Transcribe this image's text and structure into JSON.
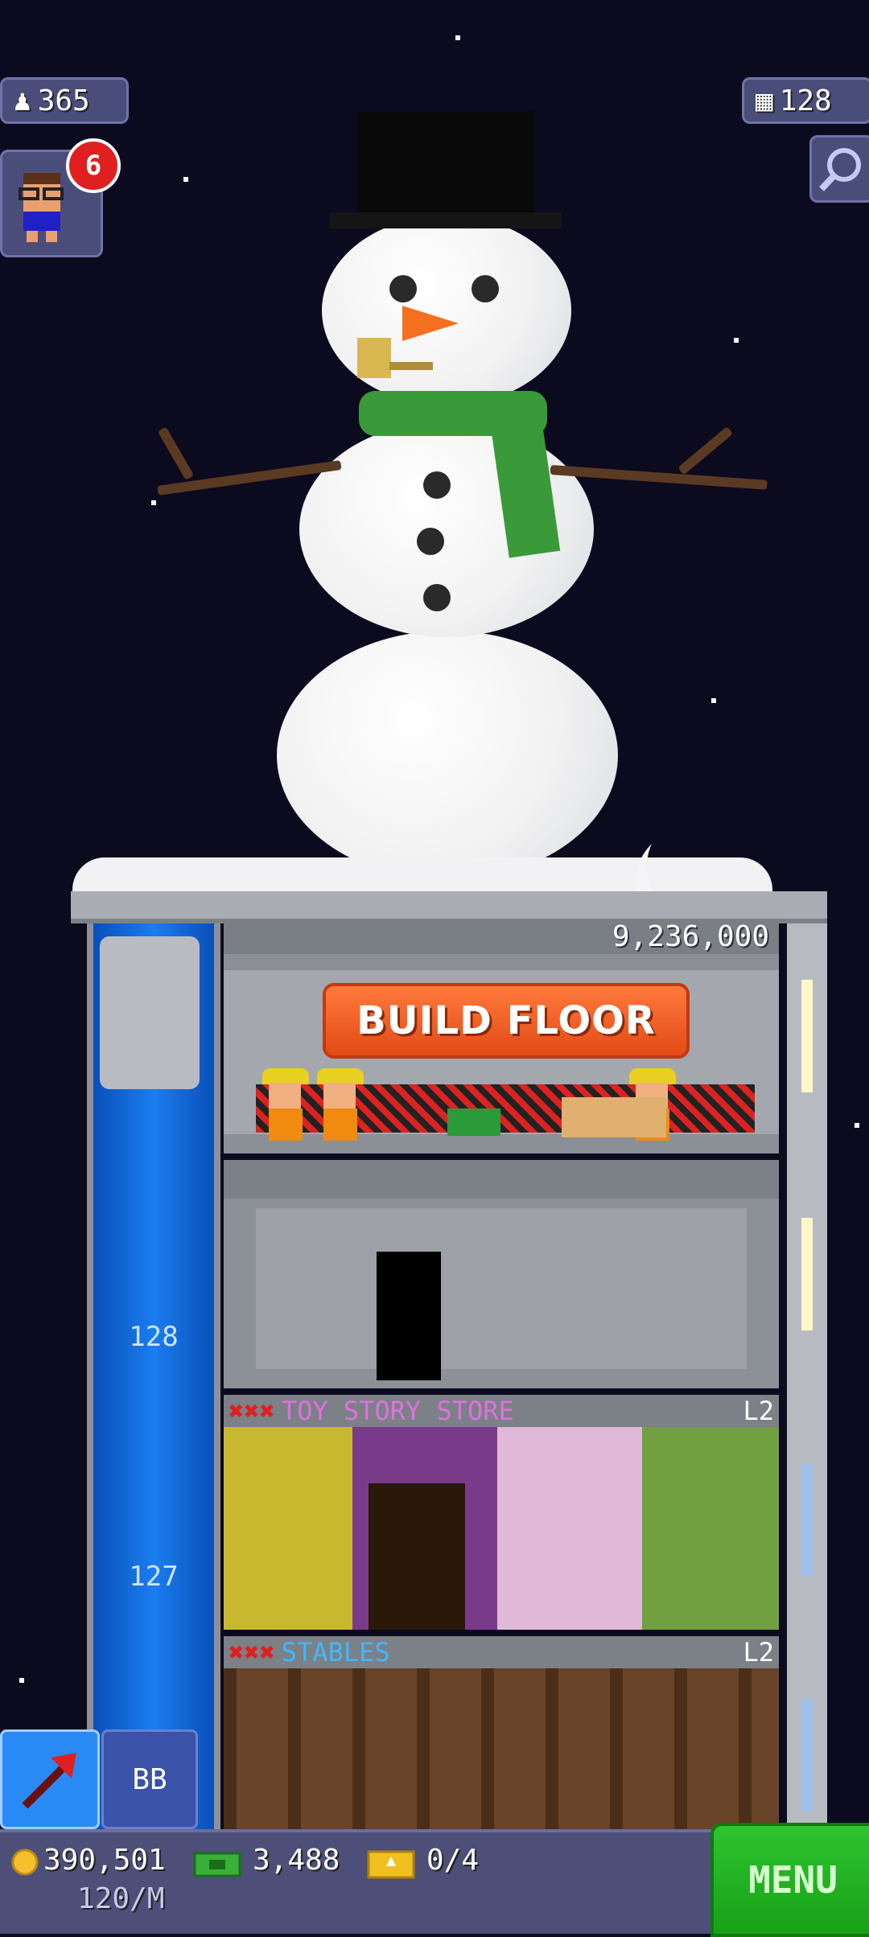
{
  "hud": {
    "population": "365",
    "floors": "128",
    "notification_count": "6"
  },
  "build_floor": {
    "cost": "9,236,000",
    "label": "BUILD FLOOR"
  },
  "elevator": {
    "floor_numbers": [
      "128",
      "127"
    ]
  },
  "floors": [
    {
      "name": "TOY STORY STORE",
      "level": "L2",
      "name_color": "#e070e0"
    },
    {
      "name": "STABLES",
      "level": "L2",
      "name_color": "#40b8ff"
    }
  ],
  "controls": {
    "bitbook_label": "BB"
  },
  "bottom": {
    "coins": "390,501",
    "coins_rate": "120/M",
    "bux": "3,488",
    "tickets": "0/4",
    "menu_label": "MENU"
  },
  "colors": {
    "sky": "#0c0a1e",
    "elevator": "#1a7df0",
    "menu": "#17a017",
    "build_sign": "#e24a16"
  }
}
